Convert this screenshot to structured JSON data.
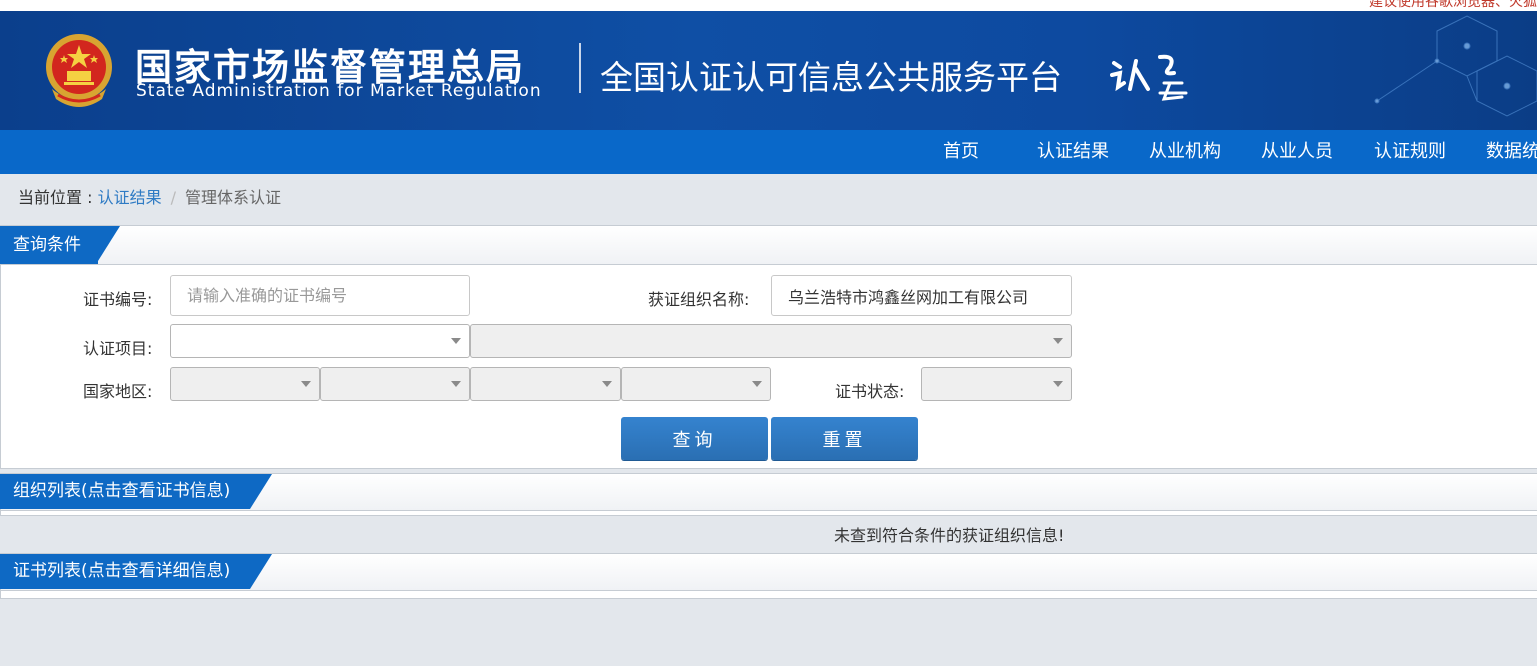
{
  "top_notice": "建议使用谷歌浏览器、火狐",
  "header": {
    "org_name_cn": "国家市场监督管理总局",
    "org_name_en": "State Administration  for  Market Regulation",
    "platform_title": "全国认证认可信息公共服务平台",
    "logo_text": "认云"
  },
  "nav": {
    "items": [
      {
        "label": "首页"
      },
      {
        "label": "认证结果"
      },
      {
        "label": "从业机构"
      },
      {
        "label": "从业人员"
      },
      {
        "label": "认证规则"
      },
      {
        "label": "数据统"
      }
    ]
  },
  "breadcrumb": {
    "prefix": "当前位置 : ",
    "link": "认证结果",
    "separator": "/",
    "current": "管理体系认证"
  },
  "query_panel": {
    "title": "查询条件",
    "cert_no_label": "证书编号:",
    "cert_no_placeholder": "请输入准确的证书编号",
    "cert_no_value": "",
    "org_name_label": "获证组织名称:",
    "org_name_value": "乌兰浩特市鸿鑫丝网加工有限公司",
    "project_label": "认证项目:",
    "region_label": "国家地区:",
    "status_label": "证书状态:",
    "search_button": "查询",
    "reset_button": "重置"
  },
  "org_list": {
    "title": "组织列表(点击查看证书信息)",
    "empty_message": "未查到符合条件的获证组织信息!"
  },
  "cert_list": {
    "title": "证书列表(点击查看详细信息)"
  },
  "colors": {
    "banner": "#0f4fa5",
    "nav": "#0968c9",
    "tab": "#0e69c4",
    "button": "#2f7bc4",
    "link": "#2f7bc4",
    "notice": "#c0392b"
  }
}
